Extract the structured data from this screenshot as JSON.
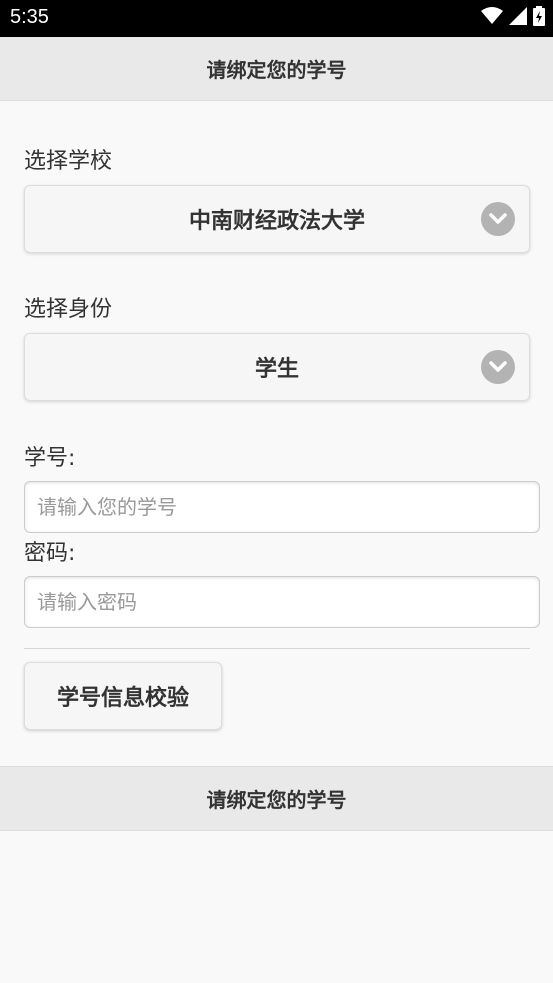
{
  "status_bar": {
    "time": "5:35",
    "icons": [
      "wifi-icon",
      "signal-icon",
      "battery-icon"
    ]
  },
  "header": {
    "title": "请绑定您的学号"
  },
  "form": {
    "school_label": "选择学校",
    "school_value": "中南财经政法大学",
    "identity_label": "选择身份",
    "identity_value": "学生",
    "student_id_label": "学号:",
    "student_id_placeholder": "请输入您的学号",
    "password_label": "密码:",
    "password_placeholder": "请输入密码",
    "verify_button_label": "学号信息校验"
  },
  "footer": {
    "title": "请绑定您的学号"
  },
  "colors": {
    "status_bar_bg": "#000000",
    "header_bg": "#e9e9e9",
    "page_bg": "#f9f9f9",
    "arrow_circle": "#b3b3b3"
  }
}
